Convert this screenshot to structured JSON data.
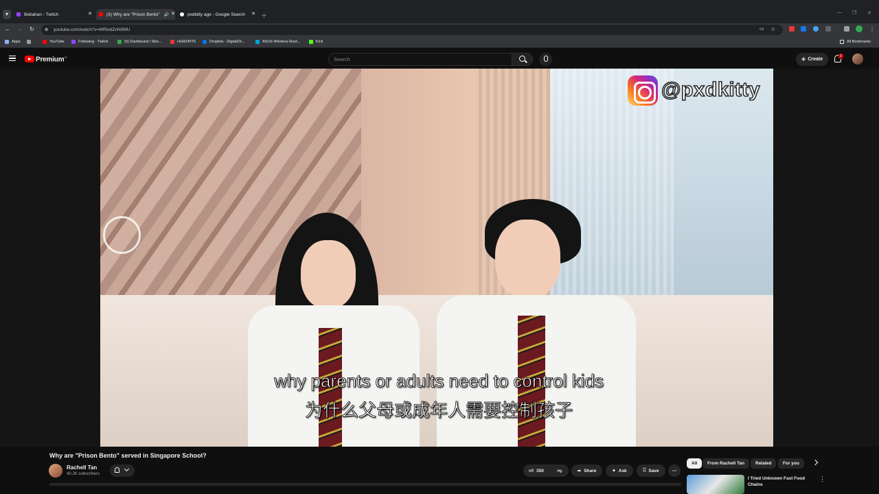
{
  "browser": {
    "tabs": [
      {
        "label": "Bebahan - Twitch",
        "fav_color": "#9146ff"
      },
      {
        "label": "(3) Why are \"Prison Bento\"",
        "fav_color": "#ff0000"
      },
      {
        "label": "pxdkitty age - Google Search",
        "fav_color": "#ffffff"
      }
    ],
    "url": "youtube.com/watch?v=MRlodZnN9MU",
    "bookmarks": [
      {
        "label": "Apps",
        "color": "#8ab4f8"
      },
      {
        "label": "YouTube",
        "color": "#ff0000"
      },
      {
        "label": "Following - Twitch",
        "color": "#9146ff"
      },
      {
        "label": "(5) Dashboard / Stre...",
        "color": "#34a853"
      },
      {
        "label": "HG8240T5",
        "color": "#e53935"
      },
      {
        "label": "Droplets - DigitalOc...",
        "color": "#0080ff"
      },
      {
        "label": "ASUS Wireless Rout...",
        "color": "#00a3e0"
      },
      {
        "label": "Kick",
        "color": "#53fc18"
      }
    ],
    "all_bookmarks": "All Bookmarks"
  },
  "youtube": {
    "brand": "Premium",
    "brand_sup": "99",
    "search_placeholder": "Search",
    "create_label": "Create",
    "notif_count": "3"
  },
  "video": {
    "watermark": "@pxdkitty",
    "subtitle_en": "why parents or adults need to control kids",
    "subtitle_zh": "为什么父母或成年人需要控制孩子",
    "title": "Why are \"Prison Bento\" served in Singapore School?",
    "channel": "Rachell Tan",
    "subscribers": "40.2K subscribers",
    "likes": "350",
    "share": "Share",
    "ask": "Ask",
    "save": "Save"
  },
  "related": {
    "chips": [
      "All",
      "From Rachell Tan",
      "Related",
      "For you"
    ],
    "first_title": "I Tried Unknown Fast Food Chains"
  }
}
